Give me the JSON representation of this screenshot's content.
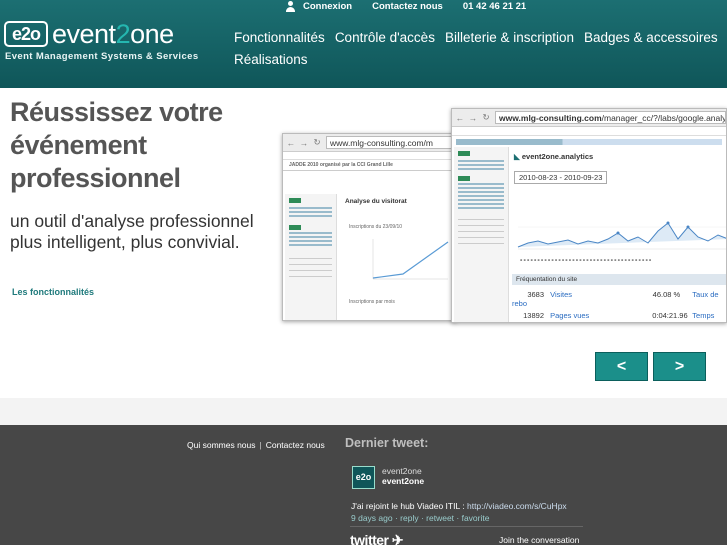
{
  "logo": {
    "mark": "e2o",
    "word_a": "event",
    "word_b": "2",
    "word_c": "one",
    "tagline": "Event Management Systems & Services"
  },
  "toplinks": {
    "login": "Connexion",
    "contact": "Contactez nous",
    "phone": "01 42 46 21 21"
  },
  "nav": {
    "items": [
      "Fonctionnalités",
      "Contrôle d'accès",
      "Billeterie & inscription",
      "Badges & accessoires",
      "Réalisations"
    ]
  },
  "hero": {
    "title": "Réussissez votre événement professionnel",
    "subtitle": "un outil d'analyse professionnel plus intelligent, plus convivial.",
    "link": "Les fonctionnalités"
  },
  "screens": {
    "back": {
      "url": "www.mlg-consulting.com/m",
      "event": "JADDE 2010 organisé par la CCI Grand Lille",
      "panel": "Analyse du visitorat",
      "chart_label": "Inscriptions du 23/09/10",
      "chart_label2": "Inscriptions par mois"
    },
    "front": {
      "url_host": "www.mlg-consulting.com",
      "url_path": "/manager_cc/?/labs/google.analytics",
      "analytics": "event2one.analytics",
      "date_range": "2010-08-23 - 2010-09-23",
      "section": "Fréquentation du site",
      "rows": [
        {
          "n": "3683",
          "label": "Visites",
          "pct": "46.08 %",
          "tail": "Taux de rebo"
        },
        {
          "n": "13892",
          "label": "Pages vues",
          "pct": "0:04:21.96",
          "tail": "Temps moyen"
        }
      ]
    }
  },
  "slider": {
    "prev": "<",
    "next": ">"
  },
  "footer": {
    "about": "Qui sommes nous",
    "contact": "Contactez nous",
    "tweet_heading": "Dernier tweet:",
    "avatar": "e2o",
    "account_name": "event2one",
    "account_handle": "event2one",
    "tweet_text": "J'ai rejoint le hub Viadeo ITIL : ",
    "tweet_link": "http://viadeo.com/s/CuHpx",
    "tweet_time": "9 days ago",
    "reply": "reply",
    "retweet": "retweet",
    "favorite": "favorite",
    "twitter": "twitter",
    "join": "Join the conversation"
  }
}
